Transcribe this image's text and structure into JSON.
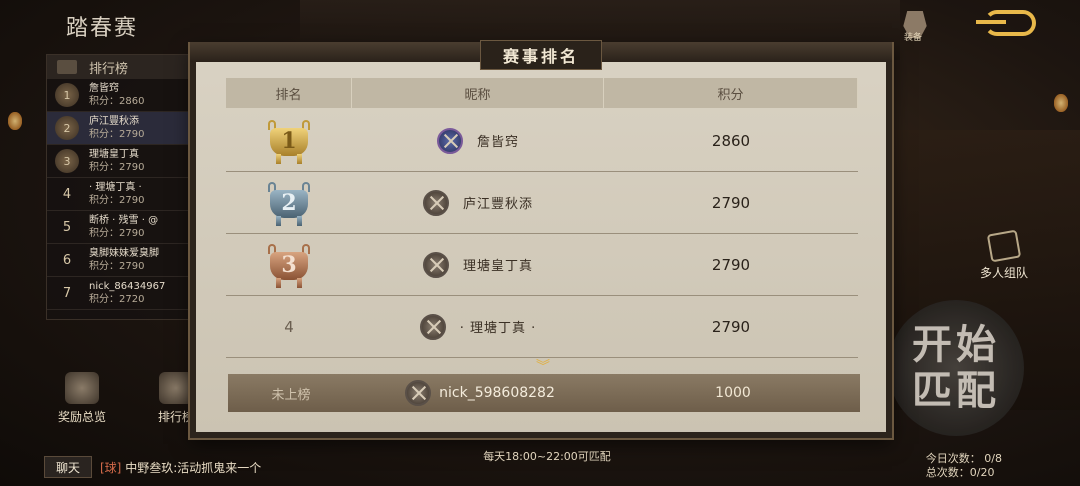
{
  "header": {
    "title": "踏春赛",
    "helmet_label": "装备"
  },
  "left_panel": {
    "title": "排行榜",
    "rows": [
      {
        "rank": "1",
        "name": "詹皆窍",
        "score_text": "积分：2860"
      },
      {
        "rank": "2",
        "name": "庐江豐秋添",
        "score_text": "积分：2790"
      },
      {
        "rank": "3",
        "name": "理塘皇丁真",
        "score_text": "积分：2790"
      },
      {
        "rank": "4",
        "name": "· 理塘丁真 ·",
        "score_text": "积分：2790"
      },
      {
        "rank": "5",
        "name": "断桥 · 残雪 · @",
        "score_text": "积分：2790"
      },
      {
        "rank": "6",
        "name": "臭脚妹妹爱臭脚",
        "score_text": "积分：2790"
      },
      {
        "rank": "7",
        "name": "nick_86434967",
        "score_text": "积分：2720"
      }
    ]
  },
  "bottom_left": {
    "reward_label": "奖励总览",
    "ranking_label": "排行榜"
  },
  "chat": {
    "button": "聊天",
    "tag": "[球]",
    "message": "中野叁玖:活动抓鬼来一个"
  },
  "right": {
    "team_label": "多人组队",
    "match_line1": "开始",
    "match_line2": "匹配",
    "today_count": "今日次数： 0/8",
    "total_count": "总次数：0/20"
  },
  "modal": {
    "title": "赛事排名",
    "columns": {
      "rank": "排名",
      "name": "昵称",
      "score": "积分"
    },
    "rows": [
      {
        "rank": "1",
        "medal": "gold",
        "name": "詹皆窍",
        "score": "2860",
        "avatar": "blue"
      },
      {
        "rank": "2",
        "medal": "silver",
        "name": "庐江豐秋添",
        "score": "2790",
        "avatar": "gray"
      },
      {
        "rank": "3",
        "medal": "bronze",
        "name": "理塘皇丁真",
        "score": "2790",
        "avatar": "gray"
      },
      {
        "rank": "4",
        "medal": "",
        "name": "· 理塘丁真 ·",
        "score": "2790",
        "avatar": "gray"
      }
    ],
    "self_row": {
      "rank": "未上榜",
      "name": "nick_598608282",
      "score": "1000"
    },
    "footer": "每天18:00~22:00可匹配"
  },
  "colors": {
    "gold": "#e0b040",
    "panel": "#d9d2c3",
    "self_row": "#7c6c56"
  }
}
